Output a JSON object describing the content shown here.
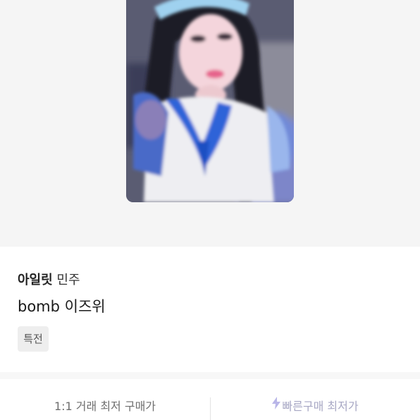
{
  "product": {
    "group": "아일릿",
    "member": "민주",
    "title": "bomb 이즈위",
    "tag": "특전"
  },
  "bottom_tabs": {
    "left_label": "1:1 거래 최저 구매가",
    "right_label": "빠른구매 최저가",
    "right_icon": "lightning-icon"
  },
  "colors": {
    "hero_bg": "#f5f5f5",
    "tag_bg": "#eeeeee",
    "right_tab_text": "#a7a7c4",
    "bolt": "#b9b6e8"
  }
}
